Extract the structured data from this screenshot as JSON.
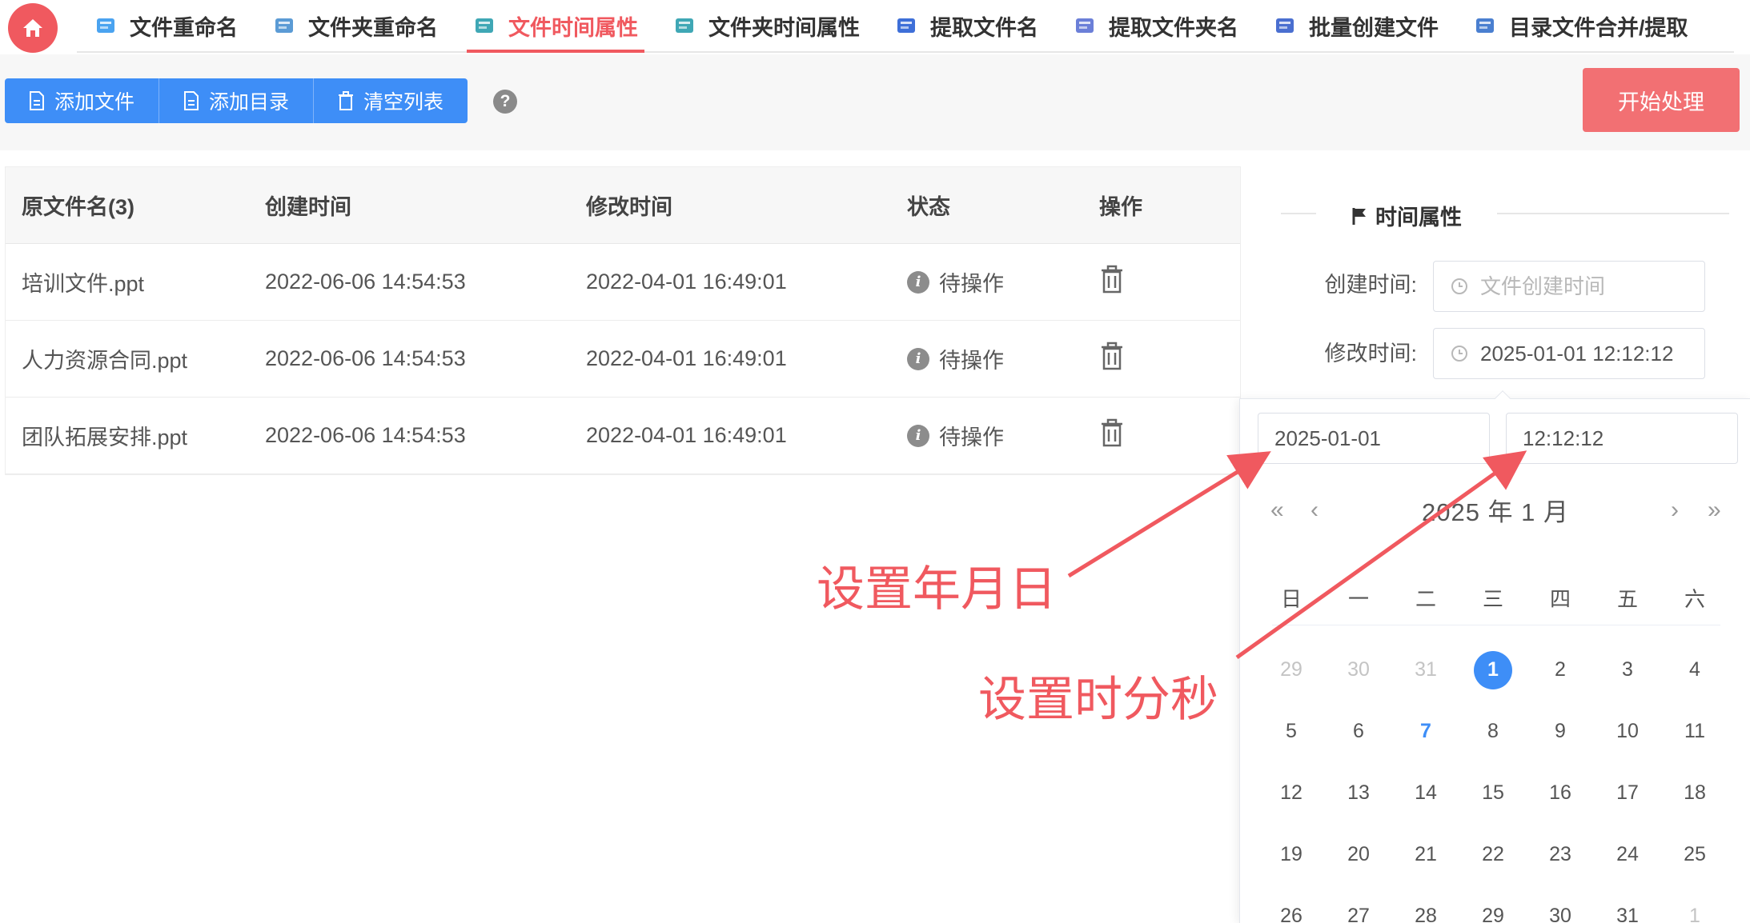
{
  "tabs": [
    {
      "label": "文件重命名",
      "icon": "file-rename-icon",
      "color": "#4aa3f0"
    },
    {
      "label": "文件夹重命名",
      "icon": "folder-rename-icon",
      "color": "#5b9bd5"
    },
    {
      "label": "文件时间属性",
      "icon": "file-time-icon",
      "color": "#3fa7b5",
      "active": true
    },
    {
      "label": "文件夹时间属性",
      "icon": "folder-time-icon",
      "color": "#3fa7b5"
    },
    {
      "label": "提取文件名",
      "icon": "extract-filename-icon",
      "color": "#3e6fd8"
    },
    {
      "label": "提取文件夹名",
      "icon": "extract-foldername-icon",
      "color": "#6b7fd8"
    },
    {
      "label": "批量创建文件",
      "icon": "batch-create-icon",
      "color": "#4a6fd0"
    },
    {
      "label": "目录文件合并/提取",
      "icon": "merge-extract-icon",
      "color": "#4a7fd0"
    }
  ],
  "toolbar": {
    "add_file": "添加文件",
    "add_dir": "添加目录",
    "clear_list": "清空列表",
    "help": "?",
    "start": "开始处理"
  },
  "table": {
    "headers": [
      "原文件名(3)",
      "创建时间",
      "修改时间",
      "状态",
      "操作"
    ],
    "rows": [
      {
        "name": "培训文件.ppt",
        "created": "2022-06-06 14:54:53",
        "modified": "2022-04-01 16:49:01",
        "status": "待操作"
      },
      {
        "name": "人力资源合同.ppt",
        "created": "2022-06-06 14:54:53",
        "modified": "2022-04-01 16:49:01",
        "status": "待操作"
      },
      {
        "name": "团队拓展安排.ppt",
        "created": "2022-06-06 14:54:53",
        "modified": "2022-04-01 16:49:01",
        "status": "待操作"
      }
    ]
  },
  "panel": {
    "title": "时间属性",
    "create_label": "创建时间:",
    "create_placeholder": "文件创建时间",
    "modify_label": "修改时间:",
    "modify_value": "2025-01-01 12:12:12"
  },
  "picker": {
    "date_value": "2025-01-01",
    "time_value": "12:12:12",
    "header": "2025 年  1 月",
    "nav_prev_year": "«",
    "nav_prev_month": "‹",
    "nav_next_month": "›",
    "nav_next_year": "»",
    "weekdays": [
      "日",
      "一",
      "二",
      "三",
      "四",
      "五",
      "六"
    ],
    "days": [
      {
        "d": "29",
        "t": "muted"
      },
      {
        "d": "30",
        "t": "muted"
      },
      {
        "d": "31",
        "t": "muted"
      },
      {
        "d": "1",
        "t": "selected"
      },
      {
        "d": "2",
        "t": ""
      },
      {
        "d": "3",
        "t": ""
      },
      {
        "d": "4",
        "t": ""
      },
      {
        "d": "5",
        "t": ""
      },
      {
        "d": "6",
        "t": ""
      },
      {
        "d": "7",
        "t": "today"
      },
      {
        "d": "8",
        "t": ""
      },
      {
        "d": "9",
        "t": ""
      },
      {
        "d": "10",
        "t": ""
      },
      {
        "d": "11",
        "t": ""
      },
      {
        "d": "12",
        "t": ""
      },
      {
        "d": "13",
        "t": ""
      },
      {
        "d": "14",
        "t": ""
      },
      {
        "d": "15",
        "t": ""
      },
      {
        "d": "16",
        "t": ""
      },
      {
        "d": "17",
        "t": ""
      },
      {
        "d": "18",
        "t": ""
      },
      {
        "d": "19",
        "t": ""
      },
      {
        "d": "20",
        "t": ""
      },
      {
        "d": "21",
        "t": ""
      },
      {
        "d": "22",
        "t": ""
      },
      {
        "d": "23",
        "t": ""
      },
      {
        "d": "24",
        "t": ""
      },
      {
        "d": "25",
        "t": ""
      },
      {
        "d": "26",
        "t": ""
      },
      {
        "d": "27",
        "t": ""
      },
      {
        "d": "28",
        "t": ""
      },
      {
        "d": "29",
        "t": ""
      },
      {
        "d": "30",
        "t": ""
      },
      {
        "d": "31",
        "t": ""
      },
      {
        "d": "1",
        "t": "muted"
      }
    ]
  },
  "annotations": {
    "set_date": "设置年月日",
    "set_time": "设置时分秒",
    "color": "#f0595f"
  },
  "colors": {
    "accent": "#f0595f",
    "primary": "#3e8ef7",
    "start_button": "#f27073"
  }
}
